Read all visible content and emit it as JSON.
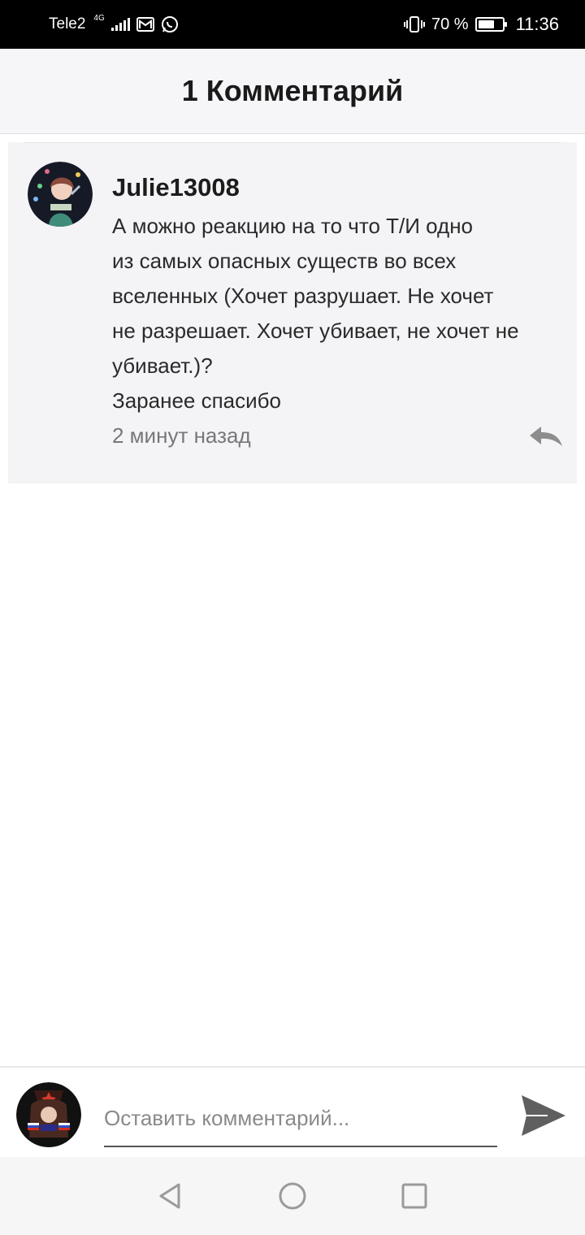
{
  "status_bar": {
    "carrier": "Tele2",
    "network_type": "4G",
    "battery_percent": "70 %",
    "battery_level": 0.7,
    "time": "11:36",
    "icons": [
      "signal-icon",
      "mail-icon",
      "whatsapp-icon",
      "vibrate-icon",
      "battery-icon"
    ]
  },
  "header": {
    "title": "1 Комментарий"
  },
  "comments": [
    {
      "username": "Julie13008",
      "text": "А можно реакцию на то что Т/И одно\nиз самых опасных существ во всех\nвселенных (Хочет разрушает. Не хочет\nне разрешает. Хочет убивает, не хочет не\nубивает.)?\nЗаранее спасибо",
      "timestamp": "2 минут назад",
      "reply_icon": "reply-icon"
    }
  ],
  "input_bar": {
    "placeholder": "Оставить комментарий...",
    "send_icon": "send-icon"
  },
  "nav_bar": {
    "icons": [
      "back-icon",
      "home-icon",
      "recents-icon"
    ]
  },
  "colors": {
    "status_bar_bg": "#000000",
    "header_bg": "#f6f5f8",
    "card_bg": "#f4f3f6",
    "muted_text": "#777777",
    "send_icon": "#5f5f5f"
  }
}
